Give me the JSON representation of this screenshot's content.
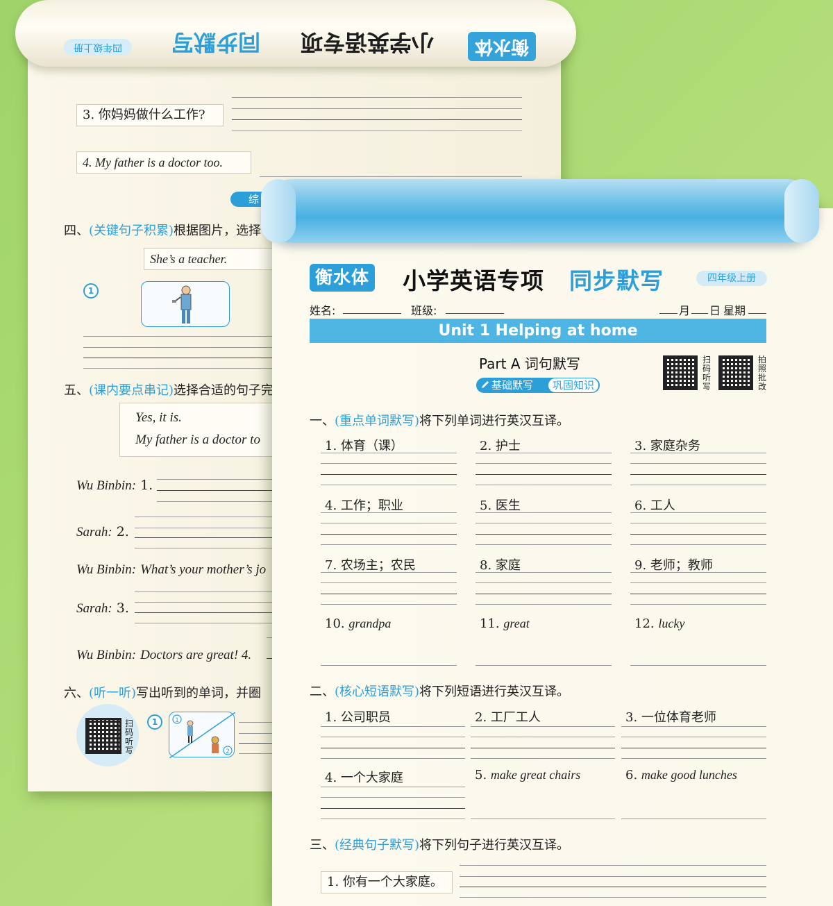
{
  "back": {
    "roll": {
      "logo": "衡水体",
      "title": "小学英语专项",
      "accent": "同步默写",
      "grade": "四年级上册"
    },
    "q3": "3. 你妈妈做什么工作?",
    "q4": "4.  My father is a doctor too.",
    "section_partial": "综",
    "sec4_num": "四、",
    "sec4_tag": "(关键句子积累)",
    "sec4_text": "根据图片，选择",
    "sec4_box": "She’s a teacher.",
    "sec4_badge": "1",
    "sec5_num": "五、",
    "sec5_tag": "(课内要点串记)",
    "sec5_text": "选择合适的句子完",
    "sec5_box_l1": "Yes, it is.",
    "sec5_box_l2": "My father is a doctor to",
    "dialog": [
      {
        "speaker": "Wu Binbin:",
        "text": "1."
      },
      {
        "speaker": "Sarah:",
        "text": "2."
      },
      {
        "speaker": "Wu Binbin:",
        "text": "What’s your mother’s jo"
      },
      {
        "speaker": "Sarah:",
        "text": "3."
      },
      {
        "speaker": "Wu Binbin:",
        "text": "Doctors are great!  4."
      }
    ],
    "sec6_num": "六、",
    "sec6_tag": "(听一听)",
    "sec6_text": "写出听到的单词，并圈",
    "sec6_qr_label": "扫码听写",
    "sec6_badge": "1",
    "pic_badge_1": "1",
    "pic_badge_2": "2"
  },
  "front": {
    "logo": "衡水体",
    "title": "小学英语专项",
    "accent": "同步默写",
    "grade": "四年级上册",
    "name_label": "姓名:",
    "class_label": "班级:",
    "date_month": "月",
    "date_day": "日",
    "date_week": "星期",
    "unit": "Unit 1  Helping at home",
    "part": "Part A  词句默写",
    "pill": "基础默写",
    "pill_sub": "巩固知识",
    "qr1_label": "扫码听写",
    "qr2_label": "拍照批改",
    "sec1_num": "一、",
    "sec1_tag": "(重点单词默写)",
    "sec1_text": "将下列单词进行英汉互译。",
    "words": [
      "1.  体育（课）",
      "2.  护士",
      "3.  家庭杂务",
      "4.  工作；职业",
      "5.  医生",
      "6.  工人",
      "7.  农场主；农民",
      "8.  家庭",
      "9.  老师；教师"
    ],
    "words_en": [
      {
        "num": "10.",
        "word": "grandpa"
      },
      {
        "num": "11.",
        "word": "great"
      },
      {
        "num": "12.",
        "word": "lucky"
      }
    ],
    "sec2_num": "二、",
    "sec2_tag": "(核心短语默写)",
    "sec2_text": "将下列短语进行英汉互译。",
    "phrases": [
      "1.  公司职员",
      "2.  工厂工人",
      "3.  一位体育老师",
      "4.  一个大家庭"
    ],
    "phrases_en": [
      {
        "num": "5.",
        "word": "make great chairs"
      },
      {
        "num": "6.",
        "word": "make good lunches"
      }
    ],
    "sec3_num": "三、",
    "sec3_tag": "(经典句子默写)",
    "sec3_text": "将下列句子进行英汉互译。",
    "sent1": "1. 你有一个大家庭。"
  }
}
